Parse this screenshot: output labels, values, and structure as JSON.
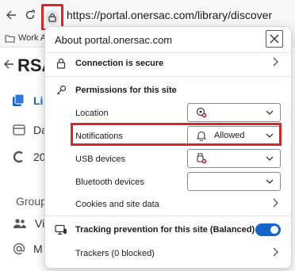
{
  "browser": {
    "url": "https://portal.onersac.com/library/discover",
    "favorites_bar": {
      "item_label": "Work A"
    }
  },
  "page_behind": {
    "logo_text": "RSA",
    "nav_items": [
      "Li",
      "Da",
      "20"
    ],
    "group_heading": "Group",
    "group_items": [
      "Vi",
      "M"
    ]
  },
  "site_info": {
    "title": "About portal.onersac.com",
    "connection_label": "Connection is secure",
    "permissions_heading": "Permissions for this site",
    "permissions": [
      {
        "label": "Location",
        "value": ""
      },
      {
        "label": "Notifications",
        "value": "Allowed"
      },
      {
        "label": "USB devices",
        "value": ""
      },
      {
        "label": "Bluetooth devices",
        "value": ""
      }
    ],
    "cookies_label": "Cookies and site data",
    "tracking_label": "Tracking prevention for this site (Balanced)",
    "tracking_enabled": true,
    "trackers_label": "Trackers (0 blocked)"
  },
  "colors": {
    "highlight": "#d9262b",
    "toggle_on": "#1466c9",
    "blocked_badge": "#d9262b"
  }
}
